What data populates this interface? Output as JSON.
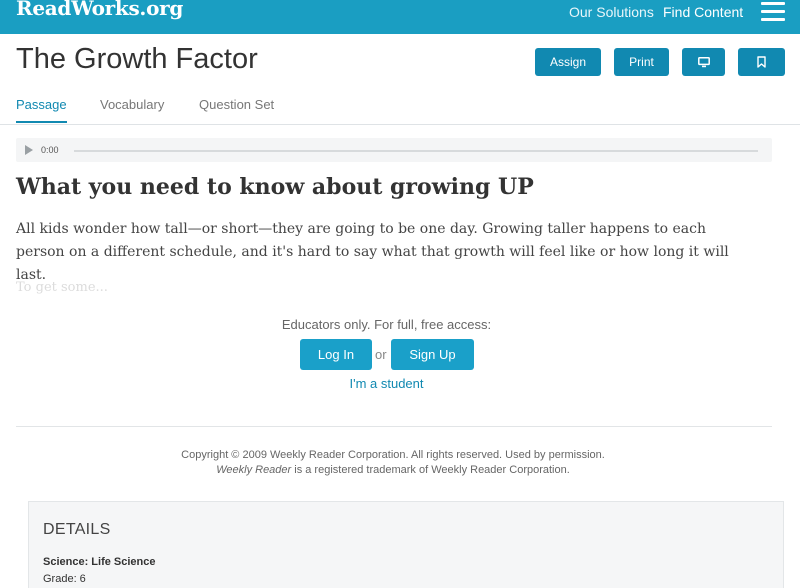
{
  "topbar": {
    "logo": "ReadWorks.org",
    "nav": [
      "Our Solutions",
      "Find Content"
    ],
    "menu_icon": "hamburger-icon",
    "color": "#1a9ec2"
  },
  "header": {
    "title": "The Growth Factor",
    "buttons": {
      "assign": "Assign",
      "print": "Print"
    },
    "icons": {
      "present": "monitor-icon",
      "bookmark": "bookmark-icon"
    },
    "tabs": [
      "Passage",
      "Vocabulary",
      "Question Set"
    ],
    "active_tab": "Passage",
    "accent": "#1189b1"
  },
  "audio": {
    "time": "0:00",
    "icon": "play-icon"
  },
  "passage": {
    "heading": "What you need to know about growing UP",
    "body": "All kids wonder how tall—or short—they are going to be one day. Growing taller happens to each person on a different schedule, and it's hard to say what that growth will feel like or how long it will last.",
    "faded": "To get some..."
  },
  "access": {
    "note": "Educators only. For full, free access:",
    "login": "Log In",
    "or": "or",
    "signup": "Sign Up",
    "student": "I'm a student"
  },
  "copyright": {
    "line1": "Copyright © 2009 Weekly Reader Corporation. All rights reserved. Used by permission.",
    "line2_em": "Weekly Reader",
    "line2_rest": " is a registered trademark of Weekly Reader Corporation."
  },
  "details": {
    "title": "DETAILS",
    "subject": "Science: Life Science",
    "grade": "Grade: 6"
  }
}
